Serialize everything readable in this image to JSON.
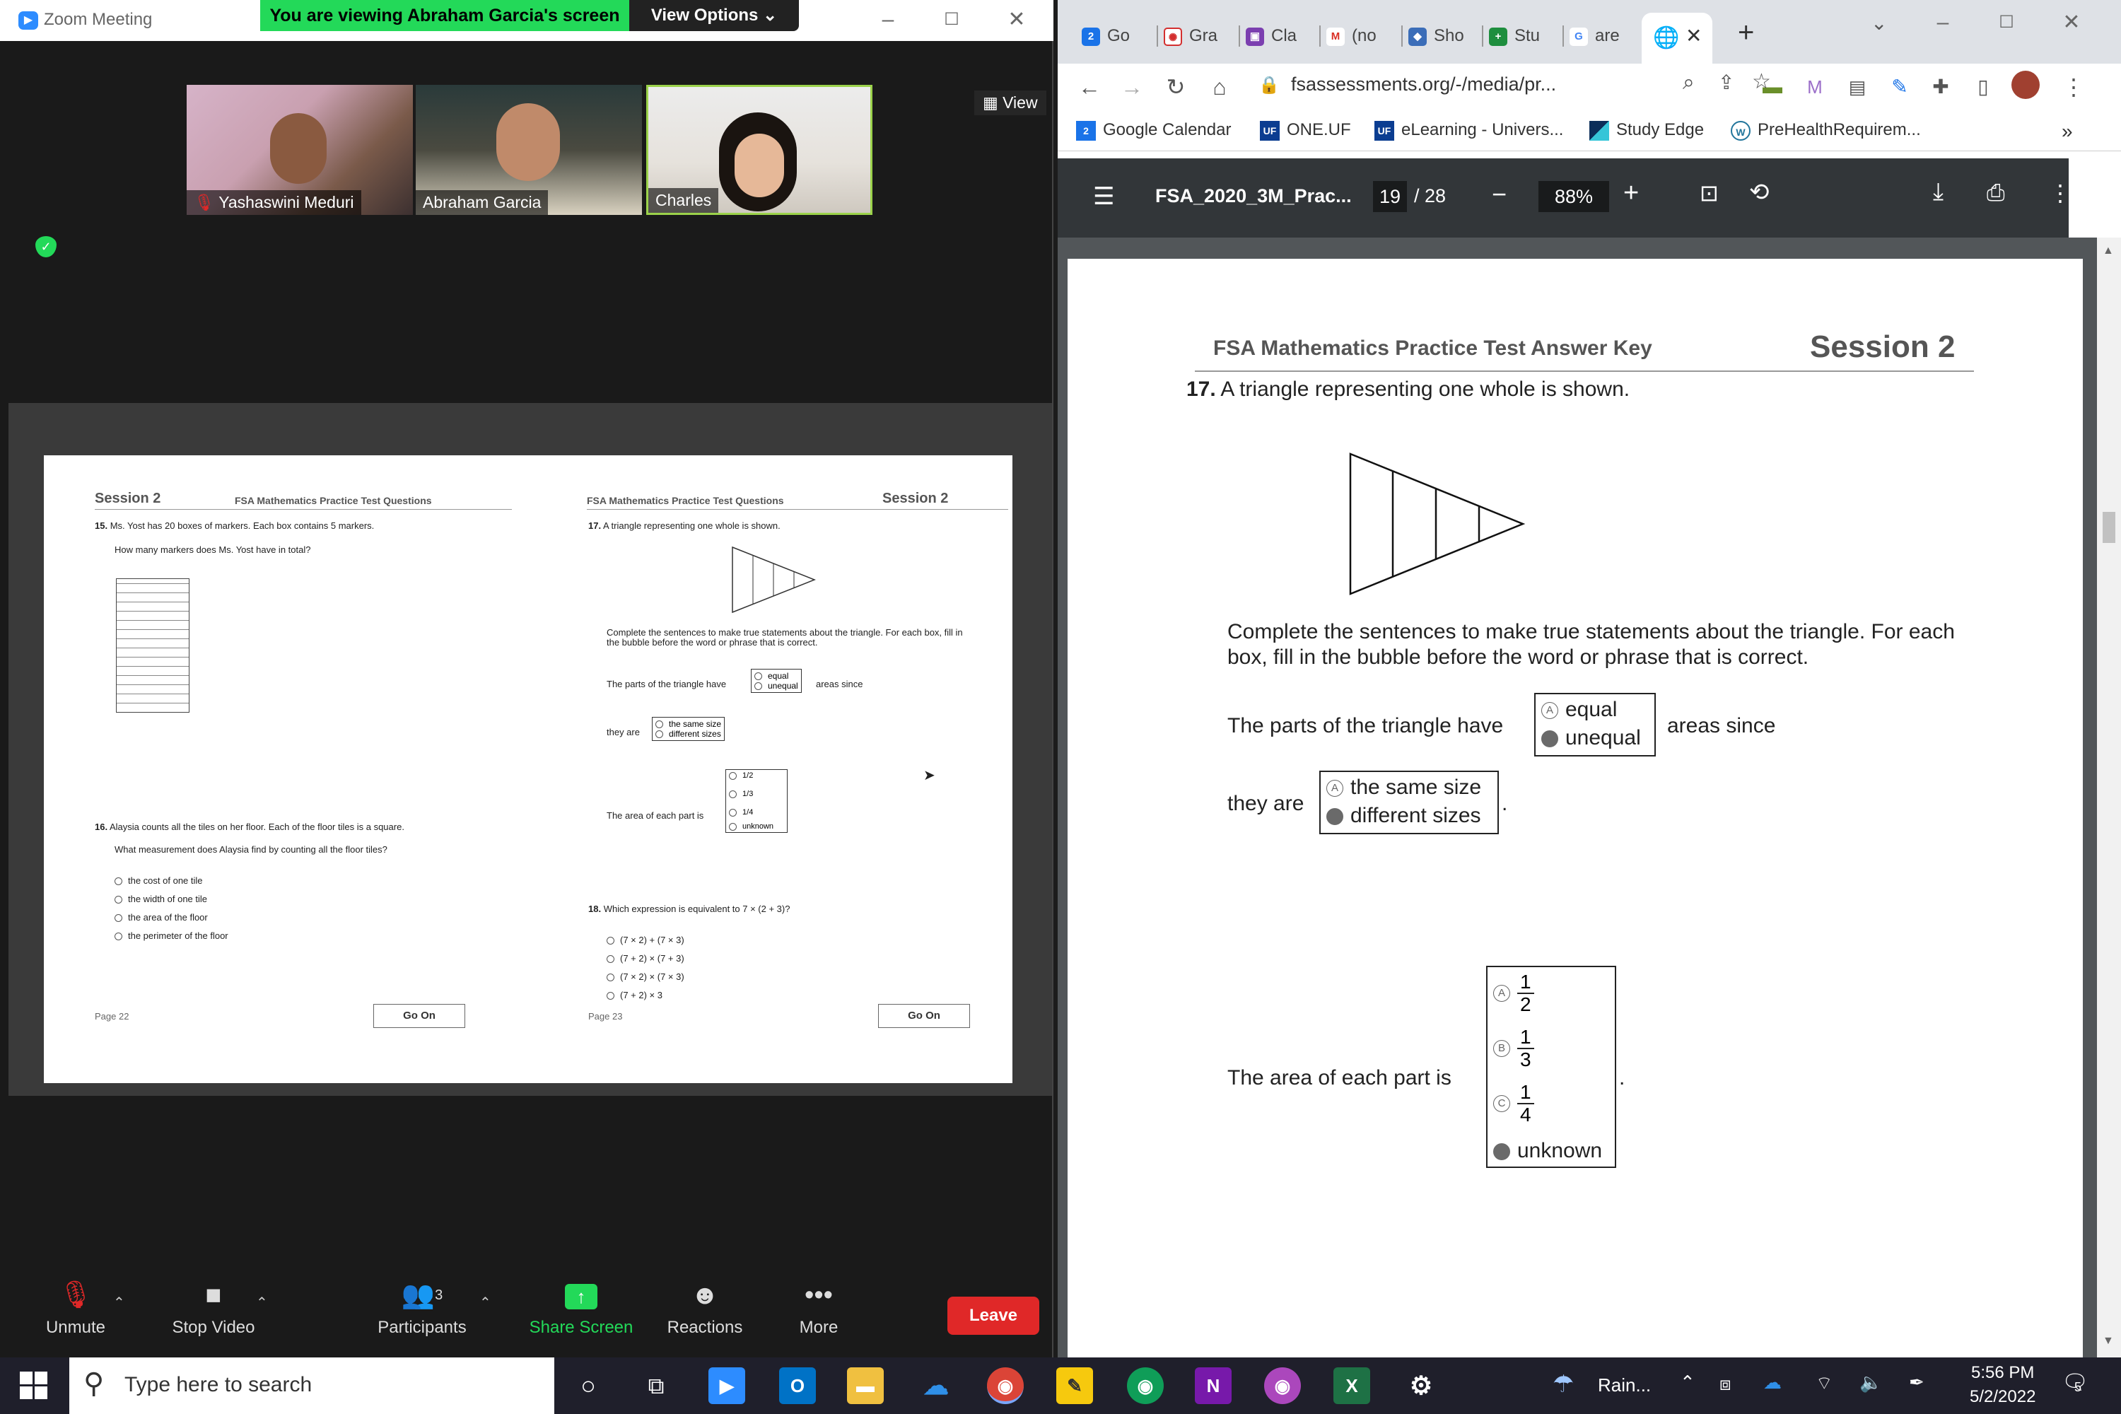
{
  "zoom": {
    "title": "Zoom Meeting",
    "banner": "You are viewing Abraham Garcia's screen",
    "view_options": "View Options ⌄",
    "view_button": "View",
    "participants": [
      {
        "name": "Yashaswini Meduri",
        "muted": true
      },
      {
        "name": "Abraham Garcia",
        "muted": false
      },
      {
        "name": "Charles",
        "muted": false
      }
    ],
    "toolbar": {
      "unmute": "Unmute",
      "stop_video": "Stop Video",
      "participants": "Participants",
      "participants_count": "3",
      "share_screen": "Share Screen",
      "reactions": "Reactions",
      "more": "More",
      "leave": "Leave"
    },
    "shared": {
      "left_session": "Session 2",
      "left_subtitle": "FSA Mathematics Practice Test Questions",
      "q15_num": "15.",
      "q15_text": "Ms. Yost has 20 boxes of markers. Each box contains 5 markers.",
      "q15_ask": "How many markers does Ms. Yost have in total?",
      "q16_num": "16.",
      "q16_text": "Alaysia counts all the tiles on her floor. Each of the floor tiles is a square.",
      "q16_ask": "What measurement does Alaysia find by counting all the floor tiles?",
      "q16_options": [
        "the cost of one tile",
        "the width of one tile",
        "the area of the floor",
        "the perimeter of the floor"
      ],
      "left_page": "Page 22",
      "go_on": "Go On",
      "right_subtitle": "FSA Mathematics Practice Test Questions",
      "right_session": "Session 2",
      "q17_num": "17.",
      "q17_text": "A triangle representing one whole is shown.",
      "q17_instr": "Complete the sentences to make true statements about the triangle. For each box, fill in the bubble before the word or phrase that is correct.",
      "s1_pre": "The parts of the triangle have",
      "s1_post": "areas since",
      "s1_opts": [
        "equal",
        "unequal"
      ],
      "s2_pre": "they are",
      "s2_opts": [
        "the same size",
        "different sizes"
      ],
      "s3_pre": "The area of each part is",
      "s3_frac": [
        [
          "1",
          "2"
        ],
        [
          "1",
          "3"
        ],
        [
          "1",
          "4"
        ]
      ],
      "s3_unknown": "unknown",
      "q18_num": "18.",
      "q18_text": "Which expression is equivalent to 7 × (2 + 3)?",
      "q18_options": [
        "(7 × 2) + (7 × 3)",
        "(7 + 2) × (7 + 3)",
        "(7 × 2) × (7 × 3)",
        "(7 + 2) × 3"
      ],
      "right_page": "Page 23"
    }
  },
  "chrome": {
    "tabs": [
      "Go",
      "Gra",
      "Cla",
      "(no",
      "Sho",
      "Stu",
      "are"
    ],
    "url": "fsassessments.org/-/media/pr...",
    "bookmarks": [
      "Google Calendar",
      "ONE.UF",
      "eLearning - Univers...",
      "Study Edge",
      "PreHealthRequirem..."
    ],
    "pdf": {
      "filename": "FSA_2020_3M_Prac...",
      "page": "19",
      "total_pages": "/ 28",
      "zoom": "88%"
    },
    "doc": {
      "header_title": "FSA Mathematics Practice Test Answer Key",
      "header_session": "Session 2",
      "q_num": "17.",
      "q_text": "A triangle representing one whole is shown.",
      "instr": "Complete the sentences to make true statements about the triangle. For each box, fill in the bubble before the word or phrase that is correct.",
      "s1_pre": "The parts of the triangle have",
      "s1_post": "areas since",
      "s1_opts": [
        {
          "letter": "A",
          "text": "equal",
          "selected": false
        },
        {
          "letter": "",
          "text": "unequal",
          "selected": true
        }
      ],
      "s2_pre": "they are",
      "s2_opts": [
        {
          "letter": "A",
          "text": "the same size",
          "selected": false
        },
        {
          "letter": "",
          "text": "different sizes",
          "selected": true
        }
      ],
      "s3_pre": "The area of each part is",
      "s3_opts": [
        {
          "letter": "A",
          "num": "1",
          "den": "2",
          "selected": false
        },
        {
          "letter": "B",
          "num": "1",
          "den": "3",
          "selected": false
        },
        {
          "letter": "C",
          "num": "1",
          "den": "4",
          "selected": false
        }
      ],
      "s3_unknown": "unknown"
    }
  },
  "taskbar": {
    "search_placeholder": "Type here to search",
    "weather": "Rain...",
    "time": "5:56 PM",
    "date": "5/2/2022",
    "notifications": "5"
  }
}
